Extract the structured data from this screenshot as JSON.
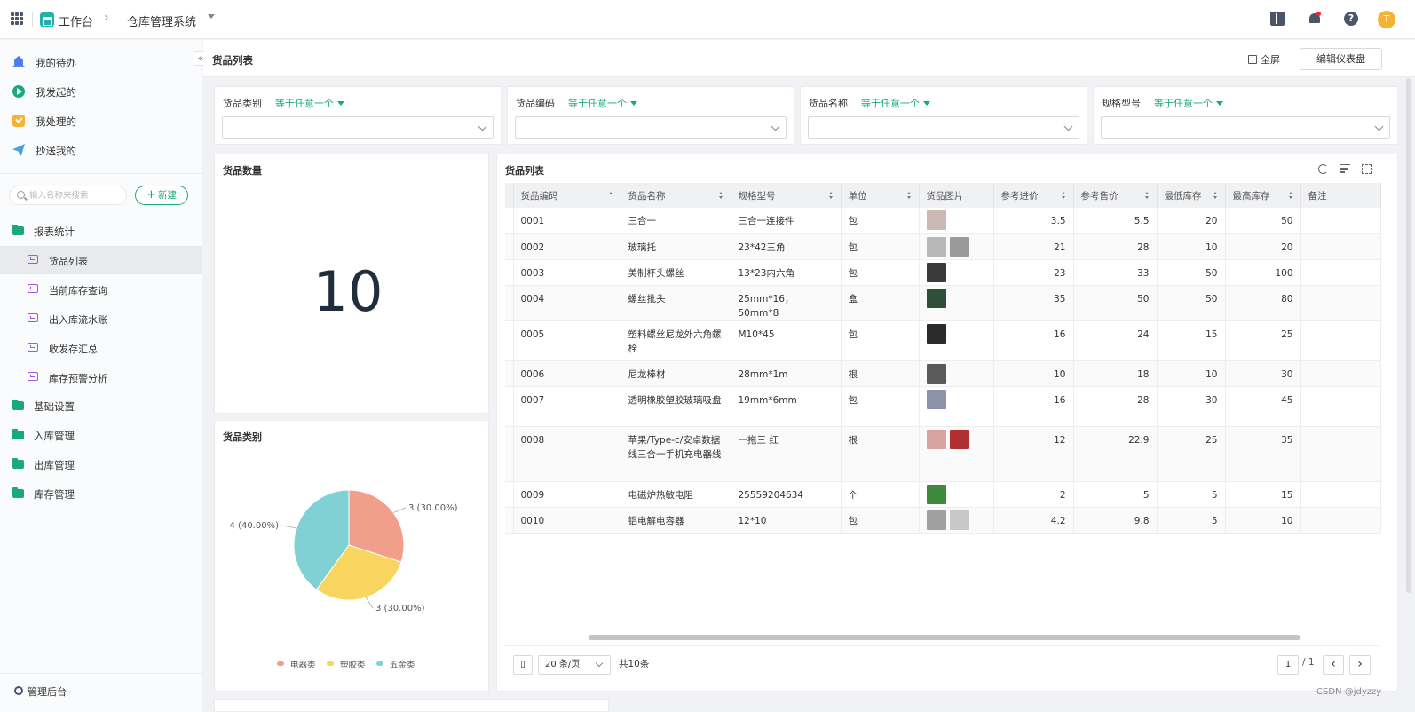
{
  "topbar": {
    "workspace_label": "工作台",
    "breadcrumb_sep": "›",
    "app_name": "仓库管理系统",
    "help_label": "?",
    "avatar_initial": "T"
  },
  "sidebar": {
    "top_items": [
      {
        "label": "我的待办",
        "icon": "bell-icon",
        "color": "#4b7bec"
      },
      {
        "label": "我发起的",
        "icon": "play-icon",
        "color": "#1aa97d"
      },
      {
        "label": "我处理的",
        "icon": "check-icon",
        "color": "#f5b335"
      },
      {
        "label": "抄送我的",
        "icon": "send-icon",
        "color": "#4aa3df"
      }
    ],
    "search_placeholder": "输入名称来搜索",
    "new_button_plus": "+",
    "new_button": "新建",
    "groups": [
      {
        "label": "报表统计"
      },
      {
        "label": "基础设置"
      },
      {
        "label": "入库管理"
      },
      {
        "label": "出库管理"
      },
      {
        "label": "库存管理"
      }
    ],
    "report_items": [
      {
        "label": "货品列表",
        "active": true
      },
      {
        "label": "当前库存查询",
        "active": false
      },
      {
        "label": "出入库流水账",
        "active": false
      },
      {
        "label": "收发存汇总",
        "active": false
      },
      {
        "label": "库存预警分析",
        "active": false
      }
    ],
    "footer_label": "管理后台",
    "collapse_glyph": "«"
  },
  "header": {
    "title": "货品列表",
    "fullscreen_label": "全屏",
    "edit_button": "编辑仪表盘"
  },
  "filters": [
    {
      "label": "货品类别",
      "operator": "等于任意一个",
      "value": ""
    },
    {
      "label": "货品编码",
      "operator": "等于任意一个",
      "value": ""
    },
    {
      "label": "货品名称",
      "operator": "等于任意一个",
      "value": ""
    },
    {
      "label": "规格型号",
      "operator": "等于任意一个",
      "value": ""
    }
  ],
  "count_card": {
    "title": "货品数量",
    "value": "10"
  },
  "pie_card": {
    "title": "货品类别"
  },
  "chart_data": {
    "type": "pie",
    "title": "货品类别",
    "slices": [
      {
        "name": "电器类",
        "value": 3,
        "label": "3 (30.00%)",
        "color": "#f0a08a"
      },
      {
        "name": "塑胶类",
        "value": 3,
        "label": "3 (30.00%)",
        "color": "#f7d55f"
      },
      {
        "name": "五金类",
        "value": 4,
        "label": "4 (40.00%)",
        "color": "#7fd1d4"
      }
    ],
    "legend_position": "bottom"
  },
  "table_card": {
    "title": "货品列表",
    "columns": [
      "货品编码",
      "货品名称",
      "规格型号",
      "单位",
      "货品图片",
      "参考进价",
      "参考售价",
      "最低库存",
      "最高库存",
      "备注"
    ],
    "rows": [
      {
        "code": "0001",
        "name": "三合一",
        "spec": "三合一连接件",
        "unit": "包",
        "images": [
          "#c9b8b3"
        ],
        "cost": "3.5",
        "price": "5.5",
        "min": "20",
        "max": "50",
        "note": ""
      },
      {
        "code": "0002",
        "name": "玻璃托",
        "spec": "23*42三角",
        "unit": "包",
        "images": [
          "#b8b8b8",
          "#9a9a9a"
        ],
        "cost": "21",
        "price": "28",
        "min": "10",
        "max": "20",
        "note": ""
      },
      {
        "code": "0003",
        "name": "美制杯头螺丝",
        "spec": "13*23内六角",
        "unit": "包",
        "images": [
          "#3a3a3a"
        ],
        "cost": "23",
        "price": "33",
        "min": "50",
        "max": "100",
        "note": ""
      },
      {
        "code": "0004",
        "name": "螺丝批头",
        "spec": "25mm*16，50mm*8",
        "unit": "盒",
        "images": [
          "#2f4f3a"
        ],
        "cost": "35",
        "price": "50",
        "min": "50",
        "max": "80",
        "note": ""
      },
      {
        "code": "0005",
        "name": "塑料螺丝尼龙外六角螺栓",
        "spec": "M10*45",
        "unit": "包",
        "images": [
          "#2a2a2a"
        ],
        "cost": "16",
        "price": "24",
        "min": "15",
        "max": "25",
        "note": ""
      },
      {
        "code": "0006",
        "name": "尼龙棒材",
        "spec": "28mm*1m",
        "unit": "根",
        "images": [
          "#5a5a5a"
        ],
        "cost": "10",
        "price": "18",
        "min": "10",
        "max": "30",
        "note": ""
      },
      {
        "code": "0007",
        "name": "透明橡胶塑胶玻璃吸盘",
        "spec": "19mm*6mm",
        "unit": "包",
        "images": [
          "#8a93a8"
        ],
        "cost": "16",
        "price": "28",
        "min": "30",
        "max": "45",
        "note": ""
      },
      {
        "code": "0008",
        "name": "苹果/Type-c/安卓数据线三合一手机充电器线",
        "spec": "一拖三 红",
        "unit": "根",
        "images": [
          "#d7a3a3",
          "#b03030"
        ],
        "cost": "12",
        "price": "22.9",
        "min": "25",
        "max": "35",
        "note": ""
      },
      {
        "code": "0009",
        "name": "电磁炉热敏电阻",
        "spec": "25559204634",
        "unit": "个",
        "images": [
          "#3d8a3a"
        ],
        "cost": "2",
        "price": "5",
        "min": "5",
        "max": "15",
        "note": ""
      },
      {
        "code": "0010",
        "name": "铝电解电容器",
        "spec": "12*10",
        "unit": "包",
        "images": [
          "#a0a0a0",
          "#c8c8c8"
        ],
        "cost": "4.2",
        "price": "9.8",
        "min": "5",
        "max": "10",
        "note": ""
      }
    ],
    "page_size": "20 条/页",
    "total": "共10条",
    "page": "1",
    "page_of": "/ 1",
    "prev": "‹",
    "next": "›"
  },
  "watermark": "CSDN @jdyzzy"
}
